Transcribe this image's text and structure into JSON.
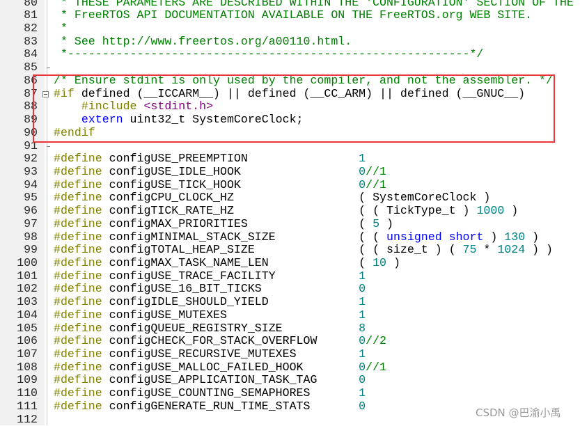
{
  "editor": {
    "first_line_number": 80,
    "colors": {
      "preprocessor": "#808000",
      "comment": "#008000",
      "number": "#008080",
      "keyword": "#0000ff",
      "include_path": "#800080",
      "highlight_box": "#e8353a"
    },
    "fold_markers": {
      "collapse_box_line": 87,
      "block_end_lines": [
        85,
        91
      ]
    },
    "highlight_lines": [
      86,
      90
    ],
    "lines": [
      [
        {
          "t": " * THESE PARAMETERS ARE DESCRIBED WITHIN THE 'CONFIGURATION' SECTION OF THE",
          "c": "cm"
        }
      ],
      [
        {
          "t": " * FreeRTOS API DOCUMENTATION AVAILABLE ON THE FreeRTOS.org WEB SITE.",
          "c": "cm"
        }
      ],
      [
        {
          "t": " *",
          "c": "cm"
        }
      ],
      [
        {
          "t": " * See http://www.freertos.org/a00110.html.",
          "c": "cm"
        }
      ],
      [
        {
          "t": " *----------------------------------------------------------*/",
          "c": "cm"
        }
      ],
      [],
      [
        {
          "t": "/* Ensure stdint is only used by the compiler, and not the assembler. */",
          "c": "cm"
        }
      ],
      [
        {
          "t": "#if",
          "c": "pp"
        },
        {
          "t": " defined (__ICCARM__) || defined (__CC_ARM) || defined (__GNUC__)",
          "c": "tx"
        }
      ],
      [
        {
          "t": "    ",
          "c": "tx"
        },
        {
          "t": "#include ",
          "c": "pp"
        },
        {
          "t": "<stdint.h>",
          "c": "str"
        }
      ],
      [
        {
          "t": "    ",
          "c": "tx"
        },
        {
          "t": "extern",
          "c": "kw"
        },
        {
          "t": " uint32_t SystemCoreClock;",
          "c": "tx"
        }
      ],
      [
        {
          "t": "#endif",
          "c": "pp"
        }
      ],
      [],
      [
        {
          "t": "#define",
          "c": "pp"
        },
        {
          "t": " configUSE_PREEMPTION                ",
          "c": "tx"
        },
        {
          "t": "1",
          "c": "num"
        }
      ],
      [
        {
          "t": "#define",
          "c": "pp"
        },
        {
          "t": " configUSE_IDLE_HOOK                 ",
          "c": "tx"
        },
        {
          "t": "0",
          "c": "num"
        },
        {
          "t": "//1",
          "c": "cm"
        }
      ],
      [
        {
          "t": "#define",
          "c": "pp"
        },
        {
          "t": " configUSE_TICK_HOOK                 ",
          "c": "tx"
        },
        {
          "t": "0",
          "c": "num"
        },
        {
          "t": "//1",
          "c": "cm"
        }
      ],
      [
        {
          "t": "#define",
          "c": "pp"
        },
        {
          "t": " configCPU_CLOCK_HZ                  ( SystemCoreClock )",
          "c": "tx"
        }
      ],
      [
        {
          "t": "#define",
          "c": "pp"
        },
        {
          "t": " configTICK_RATE_HZ                  ( ( TickType_t ) ",
          "c": "tx"
        },
        {
          "t": "1000",
          "c": "num"
        },
        {
          "t": " )",
          "c": "tx"
        }
      ],
      [
        {
          "t": "#define",
          "c": "pp"
        },
        {
          "t": " configMAX_PRIORITIES                ( ",
          "c": "tx"
        },
        {
          "t": "5",
          "c": "num"
        },
        {
          "t": " )",
          "c": "tx"
        }
      ],
      [
        {
          "t": "#define",
          "c": "pp"
        },
        {
          "t": " configMINIMAL_STACK_SIZE            ( ( ",
          "c": "tx"
        },
        {
          "t": "unsigned short",
          "c": "kw"
        },
        {
          "t": " ) ",
          "c": "tx"
        },
        {
          "t": "130",
          "c": "num"
        },
        {
          "t": " )",
          "c": "tx"
        }
      ],
      [
        {
          "t": "#define",
          "c": "pp"
        },
        {
          "t": " configTOTAL_HEAP_SIZE               ( ( size_t ) ( ",
          "c": "tx"
        },
        {
          "t": "75",
          "c": "num"
        },
        {
          "t": " * ",
          "c": "tx"
        },
        {
          "t": "1024",
          "c": "num"
        },
        {
          "t": " ) )",
          "c": "tx"
        }
      ],
      [
        {
          "t": "#define",
          "c": "pp"
        },
        {
          "t": " configMAX_TASK_NAME_LEN             ( ",
          "c": "tx"
        },
        {
          "t": "10",
          "c": "num"
        },
        {
          "t": " )",
          "c": "tx"
        }
      ],
      [
        {
          "t": "#define",
          "c": "pp"
        },
        {
          "t": " configUSE_TRACE_FACILITY            ",
          "c": "tx"
        },
        {
          "t": "1",
          "c": "num"
        }
      ],
      [
        {
          "t": "#define",
          "c": "pp"
        },
        {
          "t": " configUSE_16_BIT_TICKS              ",
          "c": "tx"
        },
        {
          "t": "0",
          "c": "num"
        }
      ],
      [
        {
          "t": "#define",
          "c": "pp"
        },
        {
          "t": " configIDLE_SHOULD_YIELD             ",
          "c": "tx"
        },
        {
          "t": "1",
          "c": "num"
        }
      ],
      [
        {
          "t": "#define",
          "c": "pp"
        },
        {
          "t": " configUSE_MUTEXES                   ",
          "c": "tx"
        },
        {
          "t": "1",
          "c": "num"
        }
      ],
      [
        {
          "t": "#define",
          "c": "pp"
        },
        {
          "t": " configQUEUE_REGISTRY_SIZE           ",
          "c": "tx"
        },
        {
          "t": "8",
          "c": "num"
        }
      ],
      [
        {
          "t": "#define",
          "c": "pp"
        },
        {
          "t": " configCHECK_FOR_STACK_OVERFLOW      ",
          "c": "tx"
        },
        {
          "t": "0",
          "c": "num"
        },
        {
          "t": "//2",
          "c": "cm"
        }
      ],
      [
        {
          "t": "#define",
          "c": "pp"
        },
        {
          "t": " configUSE_RECURSIVE_MUTEXES         ",
          "c": "tx"
        },
        {
          "t": "1",
          "c": "num"
        }
      ],
      [
        {
          "t": "#define",
          "c": "pp"
        },
        {
          "t": " configUSE_MALLOC_FAILED_HOOK        ",
          "c": "tx"
        },
        {
          "t": "0",
          "c": "num"
        },
        {
          "t": "//1",
          "c": "cm"
        }
      ],
      [
        {
          "t": "#define",
          "c": "pp"
        },
        {
          "t": " configUSE_APPLICATION_TASK_TAG      ",
          "c": "tx"
        },
        {
          "t": "0",
          "c": "num"
        }
      ],
      [
        {
          "t": "#define",
          "c": "pp"
        },
        {
          "t": " configUSE_COUNTING_SEMAPHORES       ",
          "c": "tx"
        },
        {
          "t": "1",
          "c": "num"
        }
      ],
      [
        {
          "t": "#define",
          "c": "pp"
        },
        {
          "t": " configGENERATE_RUN_TIME_STATS       ",
          "c": "tx"
        },
        {
          "t": "0",
          "c": "num"
        }
      ],
      []
    ]
  },
  "watermark": "CSDN @巴渝小禹"
}
